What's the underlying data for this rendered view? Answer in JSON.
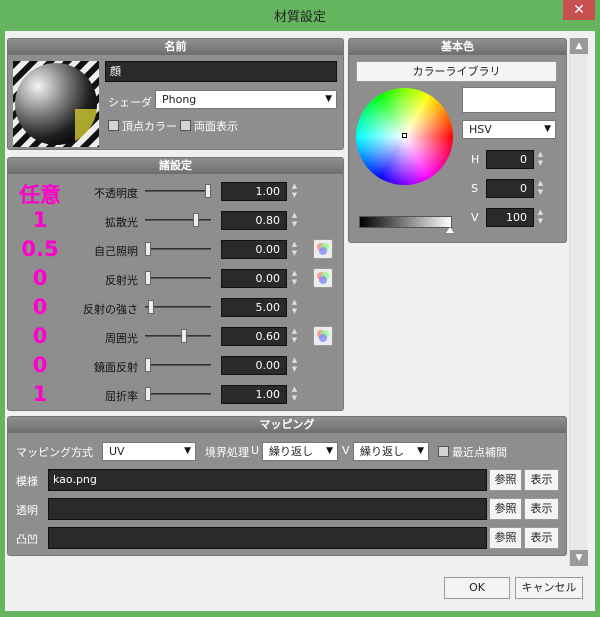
{
  "window": {
    "title": "材質設定",
    "close_label": "✕"
  },
  "name_panel": {
    "header": "名前",
    "name_value": "顔",
    "shader_label": "シェーダ",
    "shader_value": "Phong",
    "vertex_color_label": "頂点カラー",
    "double_sided_label": "両面表示"
  },
  "base_color_panel": {
    "header": "基本色",
    "library_button": "カラーライブラリ",
    "mode_value": "HSV",
    "h_label": "H",
    "h_value": "0",
    "s_label": "S",
    "s_value": "0",
    "v_label": "V",
    "v_value": "100",
    "swatch_color": "#ffffff"
  },
  "settings_panel": {
    "header": "諸設定",
    "rows": [
      {
        "annot": "任意",
        "label": "不透明度",
        "value": "1.00",
        "slider": 1.0,
        "color_btn": false
      },
      {
        "annot": "1",
        "label": "拡散光",
        "value": "0.80",
        "slider": 0.8,
        "color_btn": false
      },
      {
        "annot": "0.5",
        "label": "自己照明",
        "value": "0.00",
        "slider": 0.0,
        "color_btn": true
      },
      {
        "annot": "0",
        "label": "反射光",
        "value": "0.00",
        "slider": 0.0,
        "color_btn": true
      },
      {
        "annot": "0",
        "label": "反射の強さ",
        "value": "5.00",
        "slider": 0.05,
        "color_btn": false
      },
      {
        "annot": "0",
        "label": "周囲光",
        "value": "0.60",
        "slider": 0.6,
        "color_btn": true
      },
      {
        "annot": "0",
        "label": "鏡面反射",
        "value": "0.00",
        "slider": 0.0,
        "color_btn": false
      },
      {
        "annot": "1",
        "label": "屈折率",
        "value": "1.00",
        "slider": 0.0,
        "color_btn": false
      }
    ]
  },
  "mapping_panel": {
    "header": "マッピング",
    "method_label": "マッピング方式",
    "method_value": "UV",
    "border_label": "境界処理",
    "u_label": "U",
    "u_value": "繰り返し",
    "v_label": "V",
    "v_value": "繰り返し",
    "nearest_label": "最近点補間",
    "rows": [
      {
        "label": "模様",
        "value": "kao.png",
        "browse": "参照",
        "show": "表示"
      },
      {
        "label": "透明",
        "value": "",
        "browse": "参照",
        "show": "表示"
      },
      {
        "label": "凸凹",
        "value": "",
        "browse": "参照",
        "show": "表示"
      }
    ]
  },
  "footer": {
    "ok": "OK",
    "cancel": "キャンセル"
  }
}
